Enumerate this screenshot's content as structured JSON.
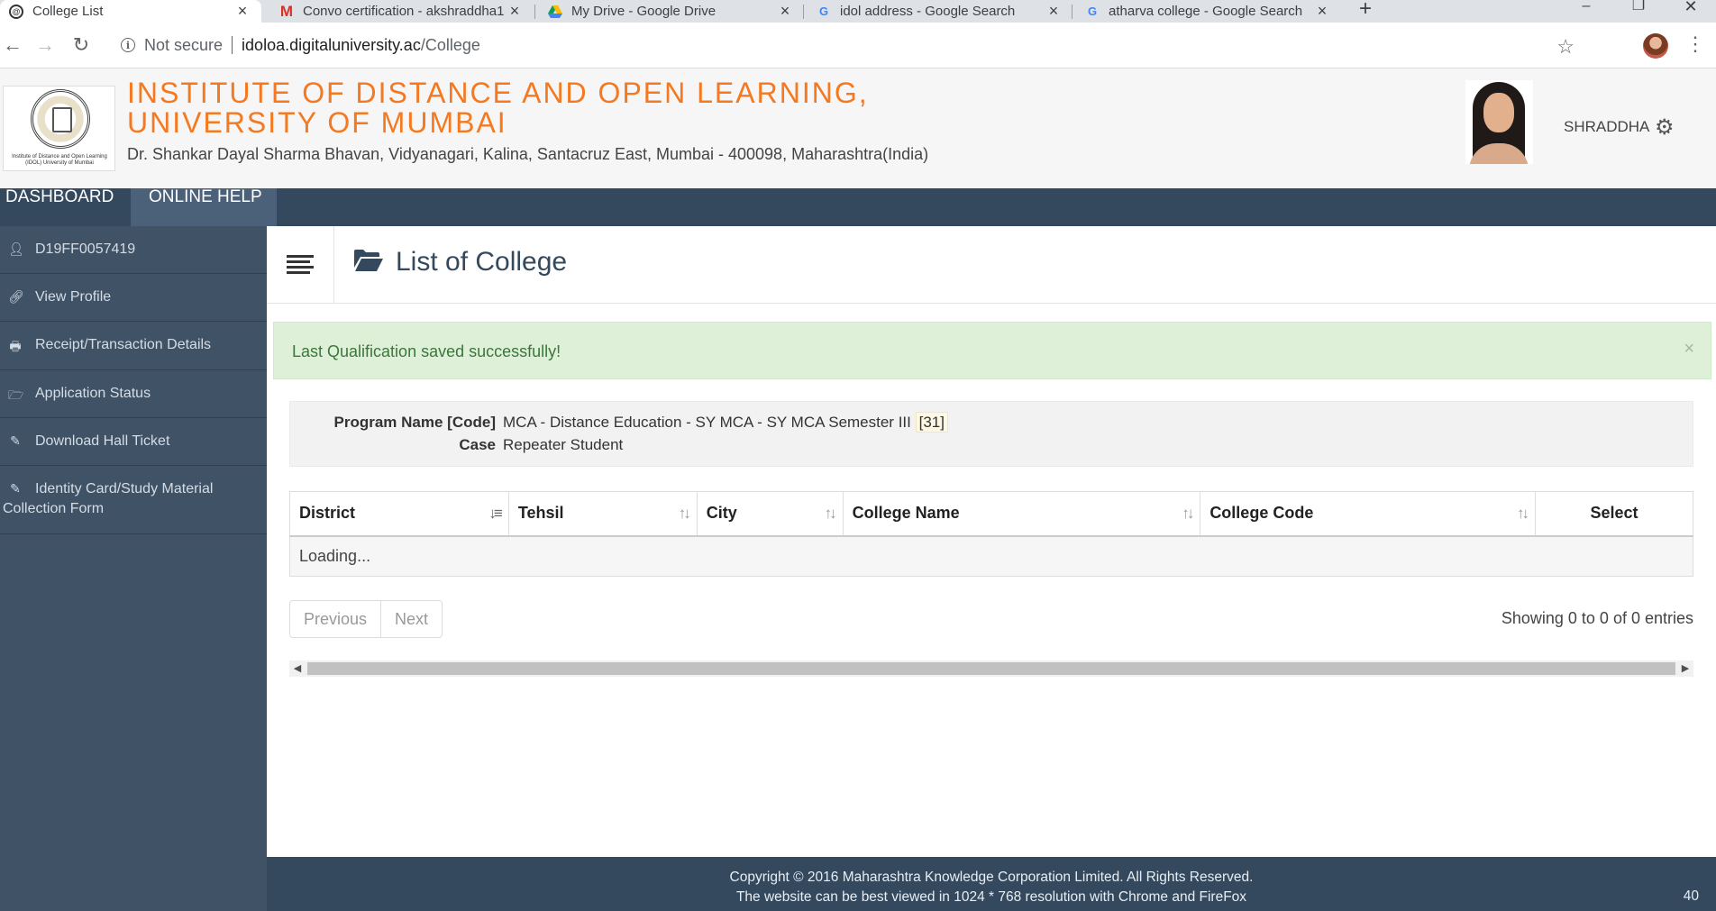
{
  "browser": {
    "tabs": [
      {
        "title": "College List",
        "icon": "site-icon",
        "active": true
      },
      {
        "title": "Convo certification - akshraddha1",
        "icon": "gmail-icon",
        "active": false
      },
      {
        "title": "My Drive - Google Drive",
        "icon": "drive-icon",
        "active": false
      },
      {
        "title": "idol address - Google Search",
        "icon": "google-icon",
        "active": false
      },
      {
        "title": "atharva college - Google Search",
        "icon": "google-icon",
        "active": false
      }
    ],
    "security_label": "Not secure",
    "url_host": "idoloa.digitaluniversity.ac",
    "url_path": "/College"
  },
  "header": {
    "title_line1": "INSTITUTE OF DISTANCE AND OPEN LEARNING,",
    "title_line2": "UNIVERSITY OF MUMBAI",
    "address": "Dr. Shankar Dayal Sharma Bhavan, Vidyanagari, Kalina, Santacruz East, Mumbai - 400098, Maharashtra(India)",
    "logo_caption": "Institute of Distance and Open Learning (IDOL) University of Mumbai",
    "username": "SHRADDHA",
    "brand_color": "#f47920"
  },
  "topnav": {
    "items": [
      {
        "label": "DASHBOARD"
      },
      {
        "label": "ONLINE HELP"
      }
    ]
  },
  "sidebar": {
    "items": [
      {
        "label": "D19FF0057419",
        "icon": "user-icon"
      },
      {
        "label": "View Profile",
        "icon": "link-icon"
      },
      {
        "label": "Receipt/Transaction Details",
        "icon": "print-icon"
      },
      {
        "label": "Application Status",
        "icon": "folder-open-icon"
      },
      {
        "label": "Download Hall Ticket",
        "icon": "ticket-icon"
      },
      {
        "label": "Identity Card/Study Material Collection Form",
        "icon": "ticket-icon"
      }
    ]
  },
  "main": {
    "page_title": "List of College",
    "alert": {
      "message": "Last Qualification saved successfully!",
      "close": "×"
    },
    "program": {
      "name_label": "Program Name [Code]",
      "name_value": "MCA - Distance Education - SY MCA - SY MCA Semester III",
      "code": "[31]",
      "case_label": "Case",
      "case_value": "Repeater Student"
    },
    "table": {
      "columns": [
        "District",
        "Tehsil",
        "City",
        "College Name",
        "College Code",
        "Select"
      ],
      "loading_text": "Loading..."
    },
    "pagination": {
      "previous": "Previous",
      "next": "Next"
    },
    "entries_info": "Showing 0 to 0 of 0 entries"
  },
  "footer": {
    "copyright": "Copyright © 2016 Maharashtra Knowledge Corporation Limited. All Rights Reserved.",
    "note": "The website can be best viewed in 1024 * 768 resolution with Chrome and FireFox",
    "page_number": "40"
  }
}
